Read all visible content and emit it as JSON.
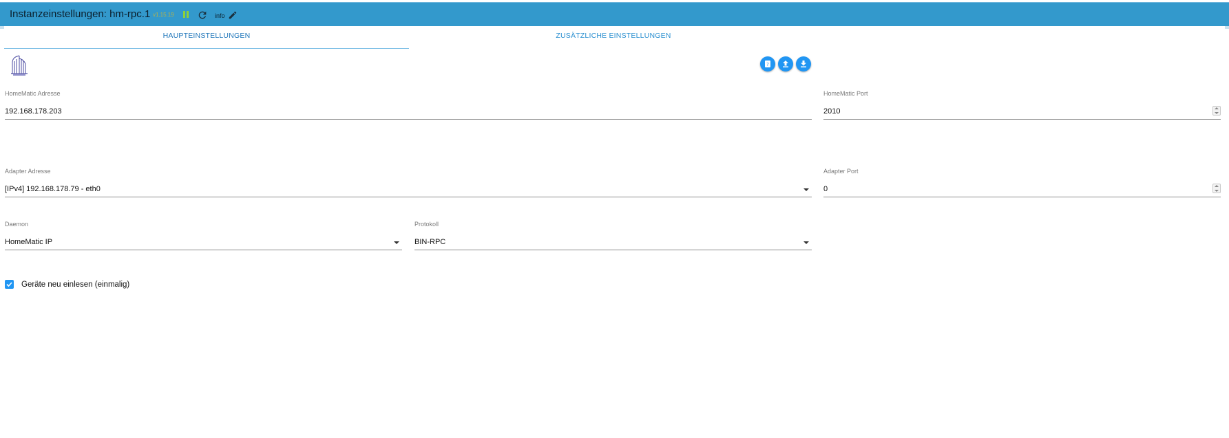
{
  "header": {
    "title": "Instanzeinstellungen: hm-rpc.1",
    "version": "v1.15.19",
    "info_label": "info",
    "icons": [
      "pause-icon",
      "reload-icon",
      "edit-icon"
    ]
  },
  "tabs": [
    {
      "label": "HAUPTEINSTELLUNGEN",
      "active": true
    },
    {
      "label": "ZUSÄTZLICHE EINSTELLUNGEN",
      "active": false
    }
  ],
  "toolbar": {
    "icons": [
      "help-icon",
      "upload-icon",
      "download-icon"
    ]
  },
  "form": {
    "homematic_address": {
      "label": "HomeMatic Adresse",
      "value": "192.168.178.203"
    },
    "homematic_port": {
      "label": "HomeMatic Port",
      "value": "2010"
    },
    "adapter_address": {
      "label": "Adapter Adresse",
      "value": "[IPv4] 192.168.178.79 - eth0"
    },
    "adapter_port": {
      "label": "Adapter Port",
      "value": "0"
    },
    "daemon": {
      "label": "Daemon",
      "value": "HomeMatic IP"
    },
    "protocol": {
      "label": "Protokoll",
      "value": "BIN-RPC"
    },
    "force_reinit": {
      "label": "Geräte neu einlesen (einmalig)",
      "checked": true
    }
  },
  "colors": {
    "header_bg": "#3399cc",
    "accent": "#2196f3",
    "tab_active": "#1c74b9"
  }
}
